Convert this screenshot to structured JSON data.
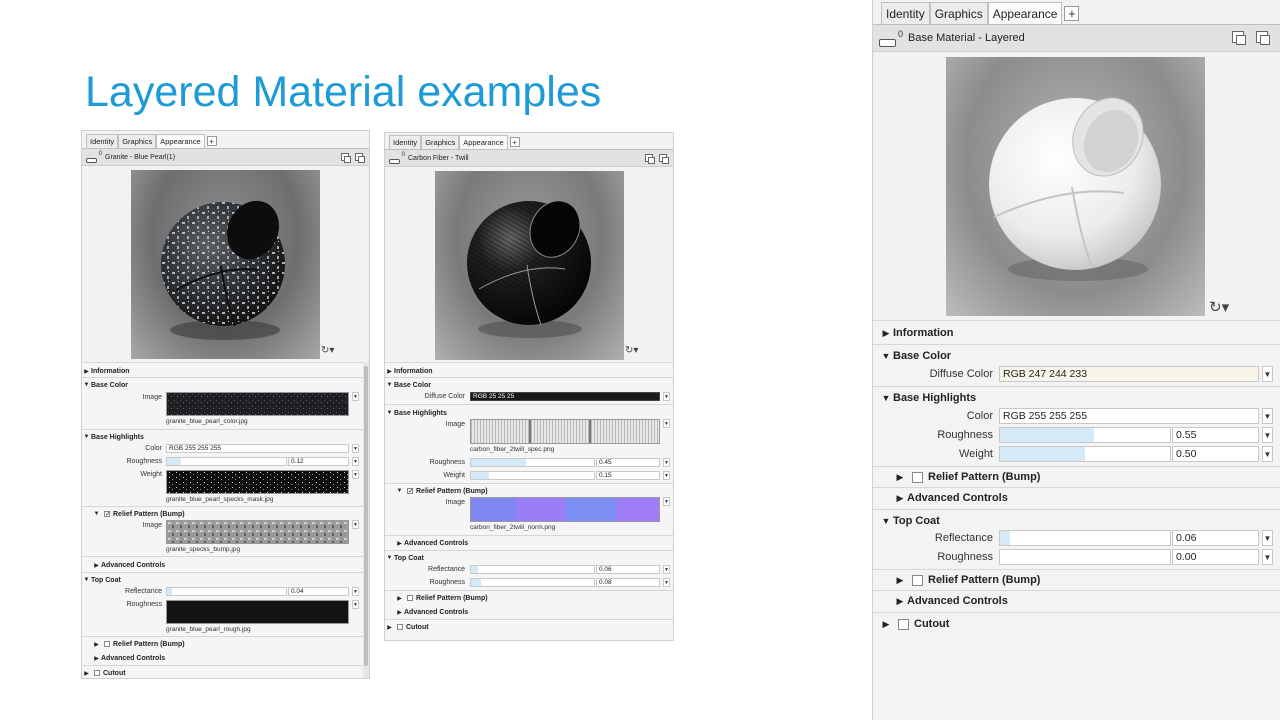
{
  "slide": {
    "title": "Layered Material examples"
  },
  "tabs": {
    "identity": "Identity",
    "graphics": "Graphics",
    "appearance": "Appearance",
    "add": "+"
  },
  "icons": {
    "material": "material-swatch-icon",
    "zero": "0",
    "assign": "assign-material-icon",
    "copy": "copy-material-icon",
    "preview_options": "↻▾",
    "dropdown": "▼",
    "tri_closed": "▶",
    "tri_open": "▼"
  },
  "panel1": {
    "material_name": "Granite - Blue Pearl(1)",
    "information": "Information",
    "base_color": {
      "header": "Base Color",
      "image_label": "Image",
      "image_file": "granite_blue_pearl_color.jpg"
    },
    "base_highlights": {
      "header": "Base Highlights",
      "color_label": "Color",
      "color_value": "RGB 255 255 255",
      "roughness_label": "Roughness",
      "roughness_value": "0.12",
      "weight_label": "Weight",
      "weight_file": "granite_blue_pearl_specks_mask.jpg"
    },
    "relief": {
      "header": "Relief Pattern (Bump)",
      "checked": true,
      "image_label": "Image",
      "image_file": "granite_specks_bump.jpg"
    },
    "advanced": "Advanced Controls",
    "top_coat": {
      "header": "Top Coat",
      "reflectance_label": "Reflectance",
      "reflectance_value": "0.04",
      "roughness_label": "Roughness",
      "roughness_file": "granite_blue_pearl_rough.jpg",
      "relief": "Relief Pattern (Bump)",
      "advanced": "Advanced Controls"
    },
    "cutout": "Cutout"
  },
  "panel2": {
    "material_name": "Carbon Fiber - Twill",
    "information": "Information",
    "base_color": {
      "header": "Base Color",
      "diffuse_label": "Diffuse Color",
      "diffuse_value": "RGB 25 25 25"
    },
    "base_highlights": {
      "header": "Base Highlights",
      "image_label": "Image",
      "image_file": "carbon_fiber_2twill_spec.png",
      "roughness_label": "Roughness",
      "roughness_value": "0.45",
      "weight_label": "Weight",
      "weight_value": "0.15"
    },
    "relief": {
      "header": "Relief Pattern (Bump)",
      "checked": true,
      "image_label": "Image",
      "image_file": "carbon_fiber_2twill_norm.png"
    },
    "advanced": "Advanced Controls",
    "top_coat": {
      "header": "Top Coat",
      "reflectance_label": "Reflectance",
      "reflectance_value": "0.06",
      "roughness_label": "Roughness",
      "roughness_value": "0.08",
      "relief": "Relief Pattern (Bump)",
      "advanced": "Advanced Controls"
    },
    "cutout": "Cutout"
  },
  "panel3": {
    "material_name": "Base Material - Layered",
    "information": "Information",
    "base_color": {
      "header": "Base Color",
      "diffuse_label": "Diffuse Color",
      "diffuse_value": "RGB 247 244 233"
    },
    "base_highlights": {
      "header": "Base Highlights",
      "color_label": "Color",
      "color_value": "RGB 255 255 255",
      "roughness_label": "Roughness",
      "roughness_value": "0.55",
      "weight_label": "Weight",
      "weight_value": "0.50",
      "relief": "Relief Pattern (Bump)",
      "advanced": "Advanced Controls"
    },
    "top_coat": {
      "header": "Top Coat",
      "reflectance_label": "Reflectance",
      "reflectance_value": "0.06",
      "roughness_label": "Roughness",
      "roughness_value": "0.00",
      "relief": "Relief Pattern (Bump)",
      "advanced": "Advanced Controls"
    },
    "cutout": "Cutout"
  },
  "colors": {
    "title": "#1e9bd6",
    "slider_fill": "#d4eaf9",
    "diffuse_p2": "#191919",
    "diffuse_p3": "#f7f4e9"
  }
}
